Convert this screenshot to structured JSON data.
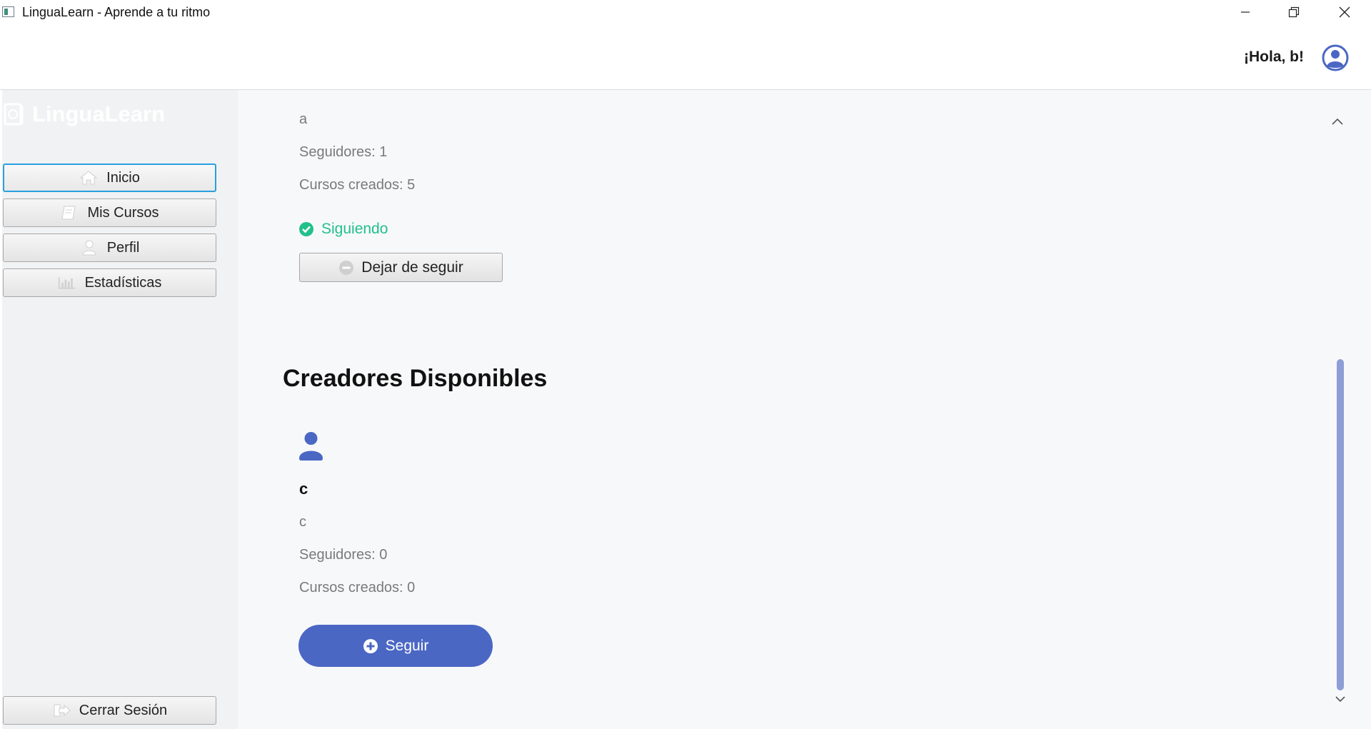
{
  "window": {
    "title": "LinguaLearn - Aprende a tu ritmo"
  },
  "header": {
    "greeting": "¡Hola, b!",
    "avatar_icon": "user-circle-icon"
  },
  "sidebar": {
    "logo_text": "LinguaLearn",
    "logo_icon": "book-globe-icon",
    "nav": [
      {
        "label": "Inicio",
        "icon": "home-icon",
        "active": true
      },
      {
        "label": "Mis Cursos",
        "icon": "book-icon",
        "active": false
      },
      {
        "label": "Perfil",
        "icon": "user-icon",
        "active": false
      },
      {
        "label": "Estadísticas",
        "icon": "bar-chart-icon",
        "active": false
      }
    ],
    "logout_label": "Cerrar Sesión",
    "logout_icon": "sign-out-icon"
  },
  "followed_creator": {
    "description": "a",
    "followers": "Seguidores: 1",
    "courses": "Cursos creados: 5",
    "status": "Siguiendo",
    "unfollow_label": "Dejar de seguir"
  },
  "available_section": {
    "title": "Creadores Disponibles",
    "creators": [
      {
        "name": "c",
        "description": "c",
        "followers": "Seguidores: 0",
        "courses": "Cursos creados: 0",
        "follow_label": "Seguir"
      }
    ]
  },
  "colors": {
    "accent": "#4b67c4",
    "success": "#22c08a",
    "scrollbar": "#8d9dd6",
    "active_border": "#2a9fe0"
  }
}
